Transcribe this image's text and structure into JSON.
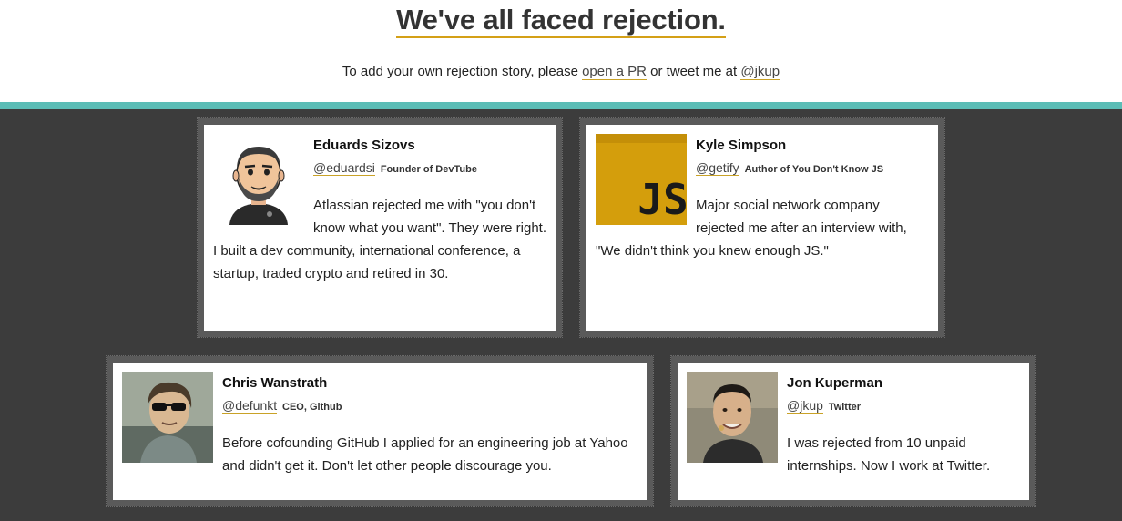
{
  "header": {
    "title": "We've all faced rejection.",
    "subtitle_prefix": "To add your own rejection story, please ",
    "subtitle_link_pr": "open a PR",
    "subtitle_middle": " or tweet me at ",
    "subtitle_link_twitter": "@jkup"
  },
  "colors": {
    "accent_underline": "#d4a017",
    "teal_bar": "#5bbdb6",
    "background": "#3c3c3c",
    "card_border": "#5a5a5a"
  },
  "cards": [
    {
      "name": "Eduards Sizovs",
      "handle": "@eduardsi",
      "role": "Founder of DevTube",
      "story": "Atlassian rejected me with \"you don't know what you want\". They were right. I built a dev community, international conference, a startup, traded crypto and retired in 30.",
      "avatar": "cartoon-avatar-icon"
    },
    {
      "name": "Kyle Simpson",
      "handle": "@getify",
      "role": "Author of You Don't Know JS",
      "story": "Major social network company rejected me after an interview with, \"We didn't think you knew enough JS.\"",
      "avatar": "js-logo-icon"
    },
    {
      "name": "Chris Wanstrath",
      "handle": "@defunkt",
      "role": "CEO, Github",
      "story": "Before cofounding GitHub I applied for an engineering job at Yahoo and didn't get it. Don't let other people discourage you.",
      "avatar": "photo-avatar"
    },
    {
      "name": "Jon Kuperman",
      "handle": "@jkup",
      "role": "Twitter",
      "story": "I was rejected from 10 unpaid internships. Now I work at Twitter.",
      "avatar": "photo-avatar"
    }
  ]
}
